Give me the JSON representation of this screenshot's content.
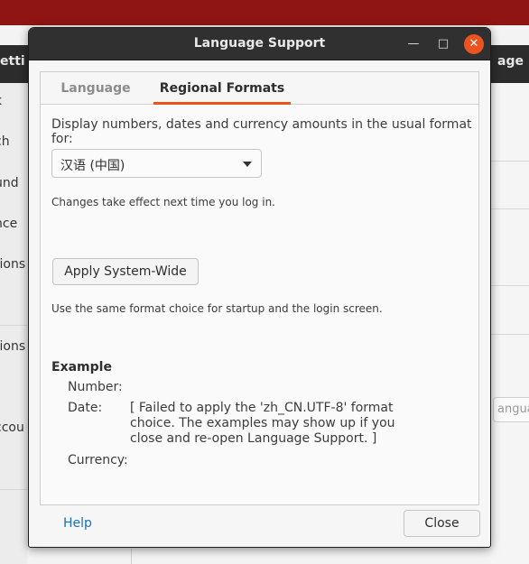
{
  "background": {
    "header_left": "etti",
    "header_right": "age",
    "sidebar_items": [
      "k",
      "ch",
      "und",
      "nce",
      "tions",
      "tions",
      "ccou"
    ],
    "right_input_text": "anguag"
  },
  "dialog": {
    "title": "Language Support",
    "tabs": [
      {
        "label": "Language",
        "selected": false
      },
      {
        "label": "Regional Formats",
        "selected": true
      }
    ],
    "description": "Display numbers, dates and currency amounts in the usual format for:",
    "format_select": {
      "value": "汉语 (中国)"
    },
    "note_login": "Changes take effect next time you log in.",
    "apply_button": "Apply System-Wide",
    "note_startup": "Use the same format choice for startup and the login screen.",
    "example": {
      "title": "Example",
      "number_label": "Number:",
      "date_label": "Date:",
      "date_value": "[ Failed to apply the 'zh_CN.UTF-8' format choice. The examples may show up if you close and re-open Language Support. ]",
      "currency_label": "Currency:"
    },
    "help_label": "Help",
    "close_label": "Close"
  },
  "colors": {
    "accent": "#e95420",
    "titlebar": "#303030",
    "link": "#1b6eb8"
  },
  "icons": {
    "minimize": "minimize-icon",
    "maximize": "maximize-icon",
    "close": "close-icon",
    "dropdown": "chevron-down-icon"
  }
}
